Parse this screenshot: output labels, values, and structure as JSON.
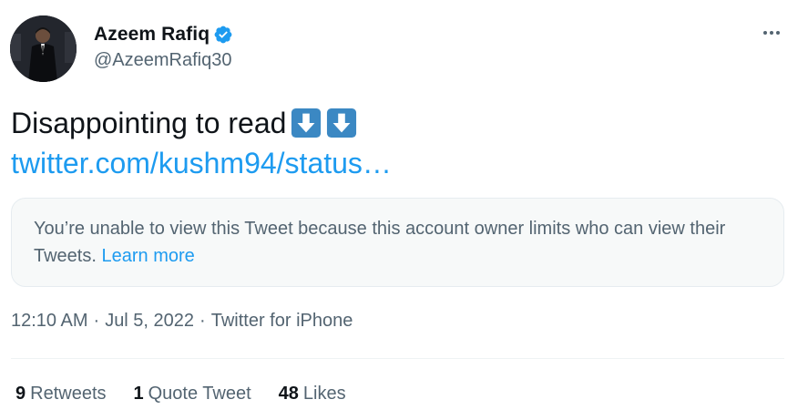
{
  "author": {
    "display_name": "Azeem Rafiq",
    "handle": "@AzeemRafiq30",
    "verified": true,
    "verified_color": "#1d9bf0"
  },
  "tweet": {
    "text": "Disappointing to read",
    "emoji": [
      "down-arrow-emoji",
      "down-arrow-emoji"
    ],
    "link_text": "twitter.com/kushm94/status…"
  },
  "quote_card": {
    "message": "You’re unable to view this Tweet because this account owner limits who can view their Tweets.",
    "learn_more": "Learn more"
  },
  "meta": {
    "time": "12:10 AM",
    "separator": "·",
    "date": "Jul 5, 2022",
    "source": "Twitter for iPhone"
  },
  "stats": {
    "retweets_count": "9",
    "retweets_label": "Retweets",
    "quotes_count": "1",
    "quotes_label": "Quote Tweet",
    "likes_count": "48",
    "likes_label": "Likes"
  },
  "colors": {
    "link": "#1d9bf0",
    "secondary_text": "#536471",
    "primary_text": "#0f1419",
    "emoji_box": "#3b88c3"
  }
}
